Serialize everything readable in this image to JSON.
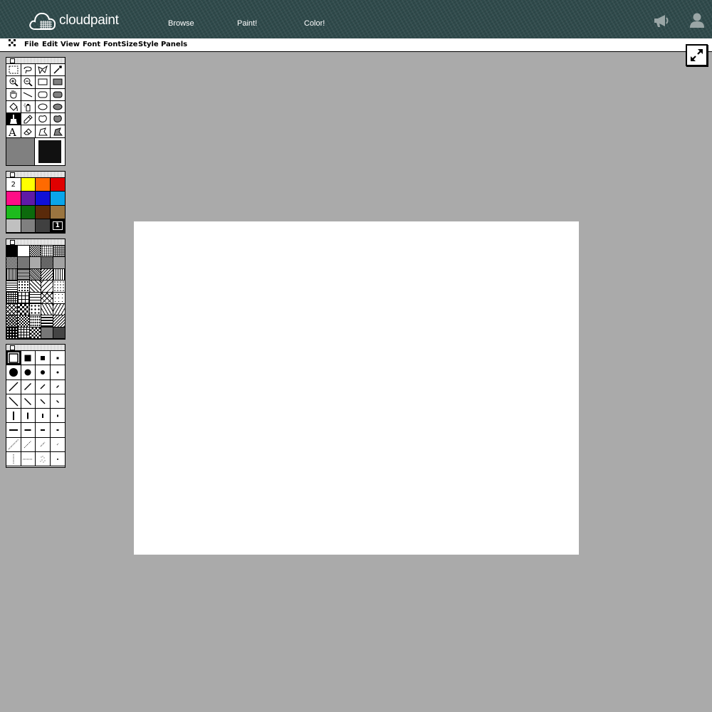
{
  "header": {
    "logo_text": "cloudpaint",
    "nav": [
      "Browse",
      "Paint!",
      "Color!"
    ],
    "icons": [
      "megaphone-icon",
      "user-icon"
    ]
  },
  "menubar": {
    "app_icon": "app-menu-icon",
    "items": [
      "File",
      "Edit",
      "View",
      "Font",
      "FontSize",
      "Style",
      "Panels"
    ]
  },
  "fullscreen": {
    "icon": "expand-arrows-icon"
  },
  "tools": {
    "items": [
      "marquee-select-icon",
      "lasso-icon",
      "polygon-lasso-icon",
      "magic-wand-icon",
      "zoom-in-icon",
      "zoom-out-icon",
      "rectangle-outline-icon",
      "rectangle-filled-icon",
      "hand-icon",
      "line-icon",
      "rounded-rect-outline-icon",
      "rounded-rect-filled-icon",
      "bucket-icon",
      "spray-icon",
      "ellipse-outline-icon",
      "ellipse-filled-icon",
      "brush-icon",
      "pencil-icon",
      "freeform-outline-icon",
      "freeform-filled-icon",
      "text-icon",
      "eraser-icon",
      "polygon-outline-icon",
      "polygon-filled-icon"
    ],
    "selected": "brush-icon",
    "fill_color": "#808080",
    "stroke_color": "#111111"
  },
  "colors": {
    "swatches": [
      {
        "hex": "#ffffff",
        "label": "2"
      },
      {
        "hex": "#ffff00"
      },
      {
        "hex": "#ff6a00"
      },
      {
        "hex": "#e00000"
      },
      {
        "hex": "#ff0d86"
      },
      {
        "hex": "#5f1aa6"
      },
      {
        "hex": "#1010d8"
      },
      {
        "hex": "#0aa5ea"
      },
      {
        "hex": "#1dbb1d"
      },
      {
        "hex": "#0c6a0c"
      },
      {
        "hex": "#5a2a0a"
      },
      {
        "hex": "#9a7540"
      },
      {
        "hex": "#c0c0c0"
      },
      {
        "hex": "#808080"
      },
      {
        "hex": "#404040"
      },
      {
        "hex": "#000000",
        "label": "1"
      }
    ]
  },
  "brushes": {
    "selected_index": 0
  }
}
